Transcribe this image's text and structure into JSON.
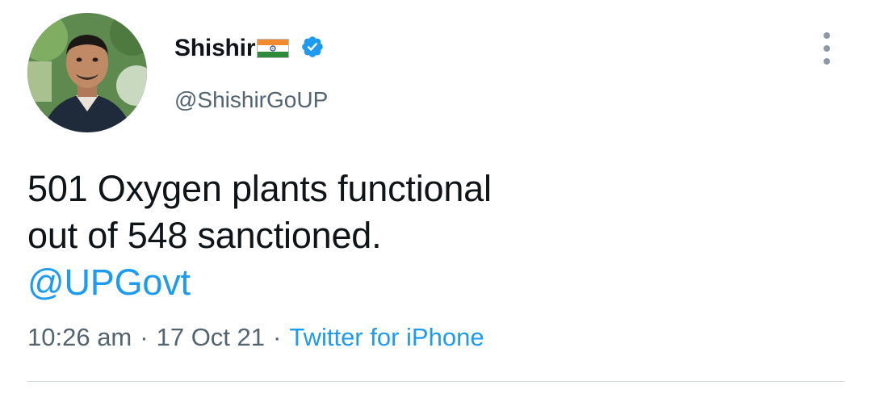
{
  "author": {
    "display_name": "Shishir",
    "handle": "@ShishirGoUP",
    "verified": true,
    "flag_icon": "india-flag-icon",
    "verified_icon": "verified-badge-icon",
    "avatar_icon": "profile-photo"
  },
  "tweet": {
    "text_line1": "501 Oxygen plants functional",
    "text_line2": "out of 548 sanctioned.",
    "mention": "@UPGovt"
  },
  "meta": {
    "time": "10:26 am",
    "separator": "·",
    "date": "17 Oct 21",
    "source": "Twitter for iPhone"
  },
  "menu": {
    "icon": "more-vertical-icon"
  },
  "colors": {
    "link": "#1d9bf0",
    "secondary_text": "#536471",
    "primary_text": "#0f1419",
    "divider": "#cfd9de"
  }
}
